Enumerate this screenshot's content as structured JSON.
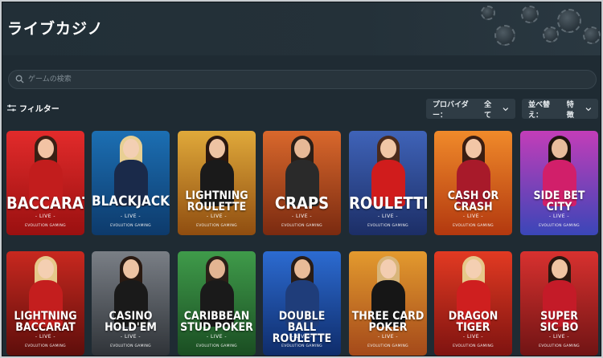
{
  "header": {
    "title": "ライブカジノ"
  },
  "search": {
    "placeholder": "ゲームの検索",
    "icon": "search-icon"
  },
  "filters": {
    "label": "フィルター",
    "provider": {
      "label": "プロバイダー：",
      "value": "全て"
    },
    "sort": {
      "label": "並べ替え：",
      "value": "特徴"
    }
  },
  "games": [
    {
      "title": "BACCARAT",
      "live": "LIVE",
      "provider": "EVOLUTION GAMING",
      "bg": [
        "#e22b2b",
        "#9a1010"
      ],
      "hair": "#3a1f14",
      "skin": "#f2c3a4",
      "outfit": "#c21d1d"
    },
    {
      "title": "BLACKJACK",
      "live": "LIVE",
      "provider": "EVOLUTION GAMING",
      "bg": [
        "#1c6fb3",
        "#0d3a6b"
      ],
      "hair": "#e8cf93",
      "skin": "#f3cfb3",
      "outfit": "#1a2a4a"
    },
    {
      "title": "LIGHTNING\nROULETTE",
      "live": "LIVE",
      "provider": "EVOLUTION GAMING",
      "bg": [
        "#e0a93a",
        "#8f4d10"
      ],
      "hair": "#2a1710",
      "skin": "#eec3a3",
      "outfit": "#1a1a1a"
    },
    {
      "title": "CRAPS",
      "live": "LIVE",
      "provider": "EVOLUTION GAMING",
      "bg": [
        "#d9682c",
        "#7a2a10"
      ],
      "hair": "#2b1f18",
      "skin": "#e7b896",
      "outfit": "#2a2a2a"
    },
    {
      "title": "ROULETTE",
      "live": "LIVE",
      "provider": "EVOLUTION GAMING",
      "bg": [
        "#3f63b8",
        "#1c2e66"
      ],
      "hair": "#4a2a1c",
      "skin": "#f0c6a6",
      "outfit": "#d01c1c"
    },
    {
      "title": "CASH OR\nCRASH",
      "live": "LIVE",
      "provider": "EVOLUTION GAMING",
      "bg": [
        "#f08a2a",
        "#b2380f"
      ],
      "hair": "#3a1e12",
      "skin": "#f2c6a6",
      "outfit": "#a81a2a"
    },
    {
      "title": "SIDE BET\nCITY",
      "live": "LIVE",
      "provider": "EVOLUTION GAMING",
      "bg": [
        "#c33db8",
        "#3a46b8"
      ],
      "hair": "#1f140f",
      "skin": "#e8bc9c",
      "outfit": "#d11f6a"
    },
    {
      "title": "LIGHTNING\nBACCARAT",
      "live": "LIVE",
      "provider": "EVOLUTION GAMING",
      "bg": [
        "#c8281f",
        "#5e0e0b"
      ],
      "hair": "#e6c88a",
      "skin": "#f4cfb2",
      "outfit": "#c41e1e"
    },
    {
      "title": "CASINO\nHOLD'EM",
      "live": "LIVE",
      "provider": "EVOLUTION GAMING",
      "bg": [
        "#7a7f86",
        "#2f3338"
      ],
      "hair": "#2a1a12",
      "skin": "#eec3a3",
      "outfit": "#1a1a1a"
    },
    {
      "title": "CARIBBEAN\nSTUD POKER",
      "live": "LIVE",
      "provider": "EVOLUTION GAMING",
      "bg": [
        "#3f9b4a",
        "#1a4d22"
      ],
      "hair": "#2b1f18",
      "skin": "#e4b592",
      "outfit": "#1a1a1a"
    },
    {
      "title": "DOUBLE BALL\nROULETTE",
      "live": "LIVE",
      "provider": "EVOLUTION GAMING",
      "bg": [
        "#2c6bd1",
        "#0f2c6a"
      ],
      "hair": "#2a1d16",
      "skin": "#e9bb98",
      "outfit": "#1f3d7a"
    },
    {
      "title": "THREE CARD\nPOKER",
      "live": "LIVE",
      "provider": "EVOLUTION GAMING",
      "bg": [
        "#e39a2e",
        "#a4491a"
      ],
      "hair": "#d8b57a",
      "skin": "#f3cdb1",
      "outfit": "#161616"
    },
    {
      "title": "DRAGON\nTIGER",
      "live": "LIVE",
      "provider": "EVOLUTION GAMING",
      "bg": [
        "#e23a22",
        "#7e1310"
      ],
      "hair": "#e6c88a",
      "skin": "#f4cfb2",
      "outfit": "#cf1f1f"
    },
    {
      "title": "SUPER\nSIC BO",
      "live": "LIVE",
      "provider": "EVOLUTION GAMING",
      "bg": [
        "#d8312f",
        "#701414"
      ],
      "hair": "#2a1810",
      "skin": "#efc4a2",
      "outfit": "#c41b28"
    }
  ]
}
